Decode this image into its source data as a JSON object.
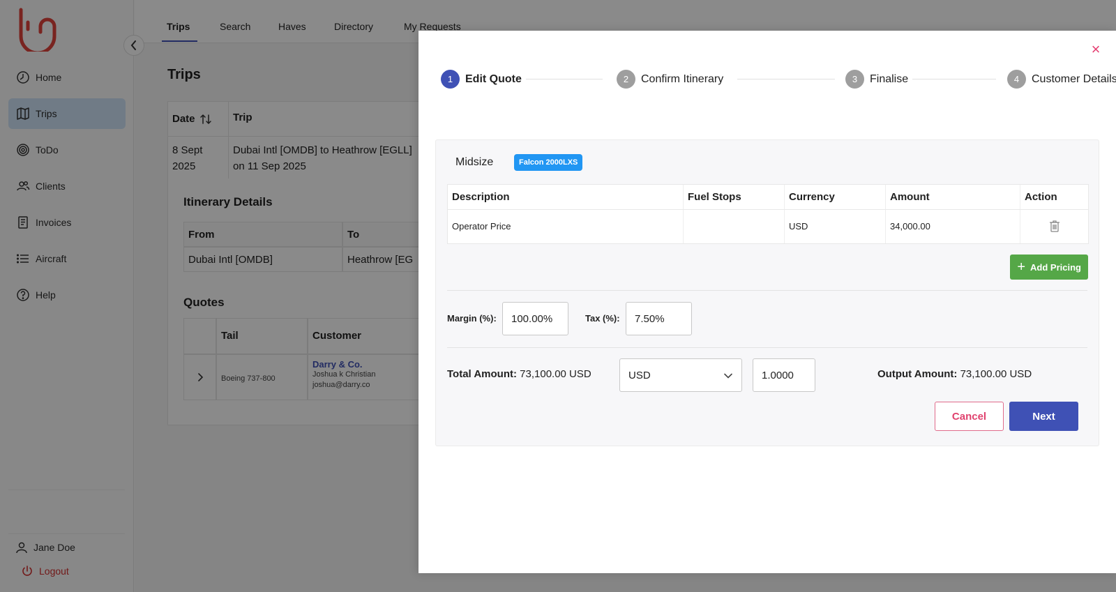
{
  "sidebar": {
    "items": [
      {
        "label": "Home",
        "icon": "clock-icon"
      },
      {
        "label": "Trips",
        "icon": "map-icon"
      },
      {
        "label": "ToDo",
        "icon": "target-icon"
      },
      {
        "label": "Clients",
        "icon": "users-icon"
      },
      {
        "label": "Invoices",
        "icon": "receipt-icon"
      },
      {
        "label": "Aircraft",
        "icon": "list-icon"
      },
      {
        "label": "Help",
        "icon": "help-icon"
      }
    ],
    "active_index": 1,
    "user_name": "Jane Doe",
    "logout_label": "Logout"
  },
  "tabs": [
    "Trips",
    "Search",
    "Haves",
    "Directory",
    "My Requests"
  ],
  "page": {
    "title": "Trips",
    "table_headers": {
      "date": "Date",
      "trip": "Trip"
    },
    "trip_row": {
      "date_line1": "8 Sept",
      "date_line2": "2025",
      "trip_line1": "Dubai Intl [OMDB] to Heathrow [EGLL]",
      "trip_line2": "on 11 Sep 2025"
    },
    "itinerary": {
      "heading": "Itinerary Details",
      "headers": {
        "from": "From",
        "to": "To"
      },
      "row": {
        "from": "Dubai Intl [OMDB]",
        "to": "Heathrow [EG"
      }
    },
    "quotes": {
      "heading": "Quotes",
      "headers": {
        "tail": "Tail",
        "customer": "Customer"
      },
      "row": {
        "tail": "Boeing 737-800",
        "company": "Darry & Co.",
        "contact": "Joshua k Christian",
        "email": "joshua@darry.co"
      }
    }
  },
  "modal": {
    "steps": [
      {
        "num": "1",
        "label": "Edit Quote"
      },
      {
        "num": "2",
        "label": "Confirm Itinerary"
      },
      {
        "num": "3",
        "label": "Finalise"
      },
      {
        "num": "4",
        "label": "Customer Details"
      }
    ],
    "active_step": 0,
    "close_symbol": "×",
    "size_category": "Midsize",
    "aircraft_badge": "Falcon 2000LXS",
    "pricing_table": {
      "headers": [
        "Description",
        "Fuel Stops",
        "Currency",
        "Amount",
        "Action"
      ],
      "rows": [
        {
          "description": "Operator Price",
          "fuel_stops": "",
          "currency": "USD",
          "amount": "34,000.00"
        }
      ]
    },
    "add_pricing_label": "Add Pricing",
    "margin_label": "Margin (%):",
    "margin_value": "100.00%",
    "tax_label": "Tax (%):",
    "tax_value": "7.50%",
    "total_label": "Total Amount:",
    "total_value": "73,100.00 USD",
    "currency_selected": "USD",
    "exchange_rate": "1.0000",
    "output_label": "Output Amount:",
    "output_value": "73,100.00 USD",
    "cancel_label": "Cancel",
    "next_label": "Next"
  },
  "colors": {
    "brand": "#e0443c",
    "primary": "#3f51b5",
    "success": "#55a747",
    "badge": "#2196f3",
    "danger": "#e0426e"
  }
}
